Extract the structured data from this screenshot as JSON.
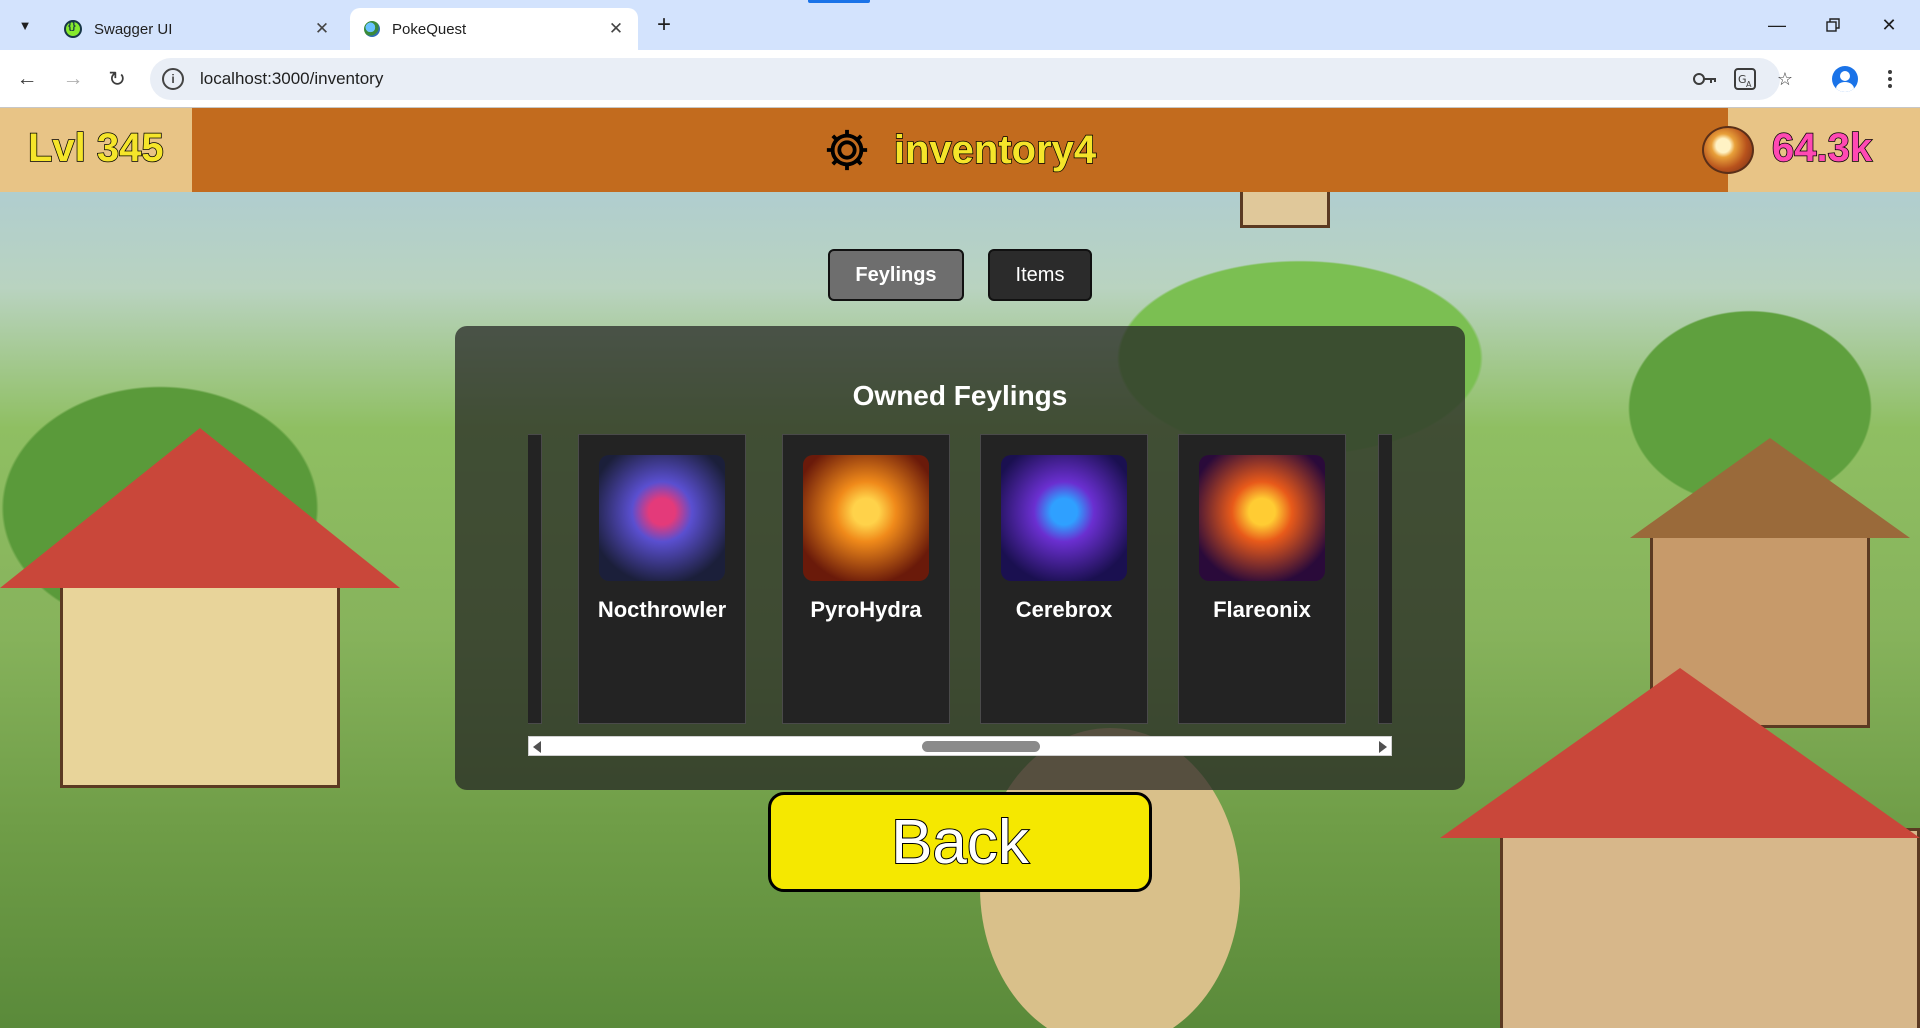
{
  "browser": {
    "tabs": [
      {
        "title": "Swagger UI",
        "active": false
      },
      {
        "title": "PokeQuest",
        "active": true
      }
    ],
    "url": "localhost:3000/inventory"
  },
  "header": {
    "level": "Lvl 345",
    "username": "inventory4",
    "coins": "64.3k"
  },
  "inventory": {
    "tabs": [
      {
        "label": "Feylings",
        "active": true
      },
      {
        "label": "Items",
        "active": false
      }
    ],
    "title": "Owned Feylings",
    "feylings": [
      {
        "name": "Nocthrowler",
        "colors": [
          "#1b1f3a",
          "#5a4fd0",
          "#e43a7a"
        ]
      },
      {
        "name": "PyroHydra",
        "colors": [
          "#6a1a0a",
          "#f08a1a",
          "#ffd24a"
        ]
      },
      {
        "name": "Cerebrox",
        "colors": [
          "#1a1050",
          "#6a2fd0",
          "#2fa0ff"
        ]
      },
      {
        "name": "Flareonix",
        "colors": [
          "#2a0a3a",
          "#e85a1a",
          "#ffcc33"
        ]
      }
    ],
    "scroll_position": 0.53
  },
  "back_label": "Back",
  "colors": {
    "header_bar": "#c26b1e",
    "header_side": "#e8c486",
    "level_text": "#f5e52a",
    "coins_text": "#ff49b3",
    "back_button": "#f5e800"
  }
}
